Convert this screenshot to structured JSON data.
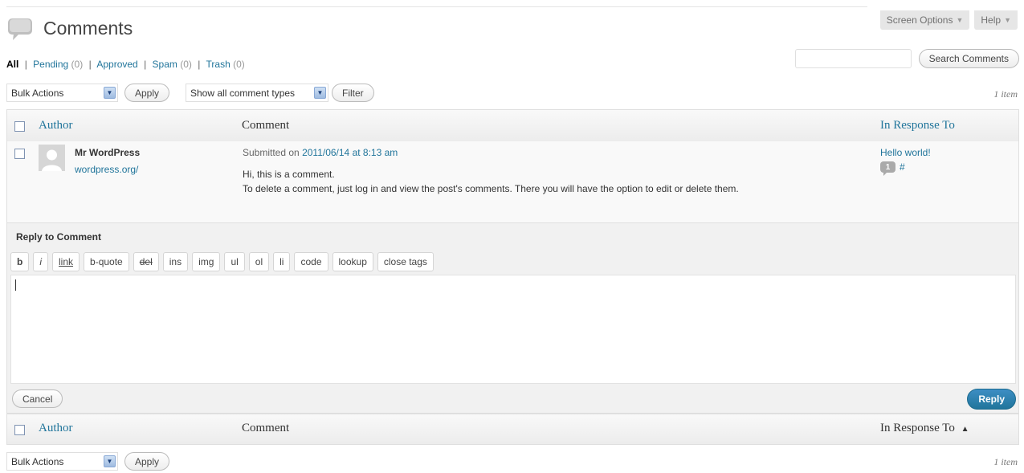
{
  "header": {
    "screen_options": "Screen Options",
    "help": "Help",
    "title": "Comments"
  },
  "filters": {
    "all": "All",
    "pending": "Pending",
    "pending_count": "(0)",
    "approved": "Approved",
    "spam": "Spam",
    "spam_count": "(0)",
    "trash": "Trash",
    "trash_count": "(0)",
    "sep": "|"
  },
  "search": {
    "value": "",
    "button": "Search Comments"
  },
  "tablenav_top": {
    "bulk_actions": "Bulk Actions",
    "apply": "Apply",
    "comment_types": "Show all comment types",
    "filter": "Filter",
    "items": "1 item"
  },
  "table": {
    "col_author": "Author",
    "col_comment": "Comment",
    "col_response": "In Response To",
    "sort_indicator": "▲"
  },
  "comment": {
    "author": "Mr WordPress",
    "author_url": "wordpress.org/",
    "submitted_prefix": "Submitted on",
    "submitted_date": "2011/06/14 at 8:13 am",
    "line1": "Hi, this is a comment.",
    "line2": "To delete a comment, just log in and view the post's comments. There you will have the option to edit or delete them.",
    "post_title": "Hello world!",
    "comment_count": "1",
    "hash": "#"
  },
  "reply": {
    "title": "Reply to Comment",
    "quicktags": [
      "b",
      "i",
      "link",
      "b-quote",
      "del",
      "ins",
      "img",
      "ul",
      "ol",
      "li",
      "code",
      "lookup",
      "close tags"
    ],
    "text": "",
    "cancel": "Cancel",
    "submit": "Reply"
  },
  "tablenav_bottom": {
    "bulk_actions": "Bulk Actions",
    "apply": "Apply",
    "items": "1 item"
  },
  "colors": {
    "link": "#21759b",
    "primary_button": "#21759b",
    "header_bg": "#ececec"
  }
}
